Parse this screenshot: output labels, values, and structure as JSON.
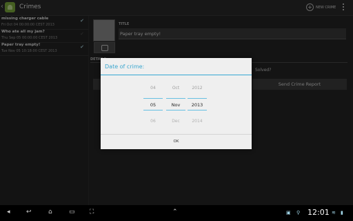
{
  "app": {
    "title": "Crimes",
    "new_crime": "NEW CRIME"
  },
  "list": [
    {
      "title": "missing charger cable",
      "date": "Fri Oct 04 00:00:00 CEST 2013",
      "solved": true
    },
    {
      "title": "Who ate all my jam?",
      "date": "Thu Sep 05 00:00:00 CEST 2013",
      "solved": false
    },
    {
      "title": "Paper tray empty!",
      "date": "Tue Nov 05 10:18:00 CEST 2013",
      "solved": true
    }
  ],
  "detail": {
    "title_label": "TITLE",
    "title_value": "Paper tray empty!",
    "details_label": "DETAILS",
    "solved_label": "Solved?",
    "report_button": "Send Crime Report"
  },
  "dialog": {
    "title": "Date of crime:",
    "day": {
      "prev": "04",
      "cur": "05",
      "next": "06"
    },
    "month": {
      "prev": "Oct",
      "cur": "Nov",
      "next": "Dec"
    },
    "year": {
      "prev": "2012",
      "cur": "2013",
      "next": "2014"
    },
    "ok": "OK"
  },
  "system": {
    "time": "12:01"
  },
  "colors": {
    "accent": "#34a7d3",
    "app_green": "#7fae3c"
  }
}
